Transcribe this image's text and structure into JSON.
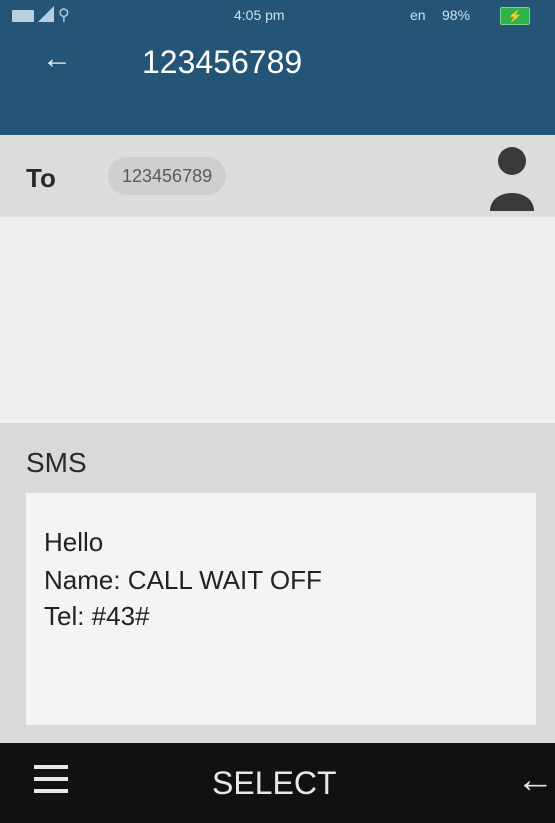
{
  "status_bar": {
    "time": "4:05 pm",
    "locale": "en",
    "battery_percent": "98%",
    "icons": [
      "sim-icon",
      "signal-icon",
      "usb-icon",
      "battery-charging-icon"
    ]
  },
  "app_bar": {
    "title": "123456789",
    "back_icon": "back-arrow-icon",
    "background_color": "#245577"
  },
  "recipient": {
    "to_label": "To",
    "number": "123456789",
    "contact_icon": "contact-person-icon"
  },
  "sms": {
    "label": "SMS",
    "lines": [
      "Hello",
      "Name: CALL WAIT OFF",
      "Tel: #43#"
    ]
  },
  "softkeys": {
    "left_icon": "menu-icon",
    "center_label": "SELECT",
    "right_icon": "back-arrow-icon"
  }
}
